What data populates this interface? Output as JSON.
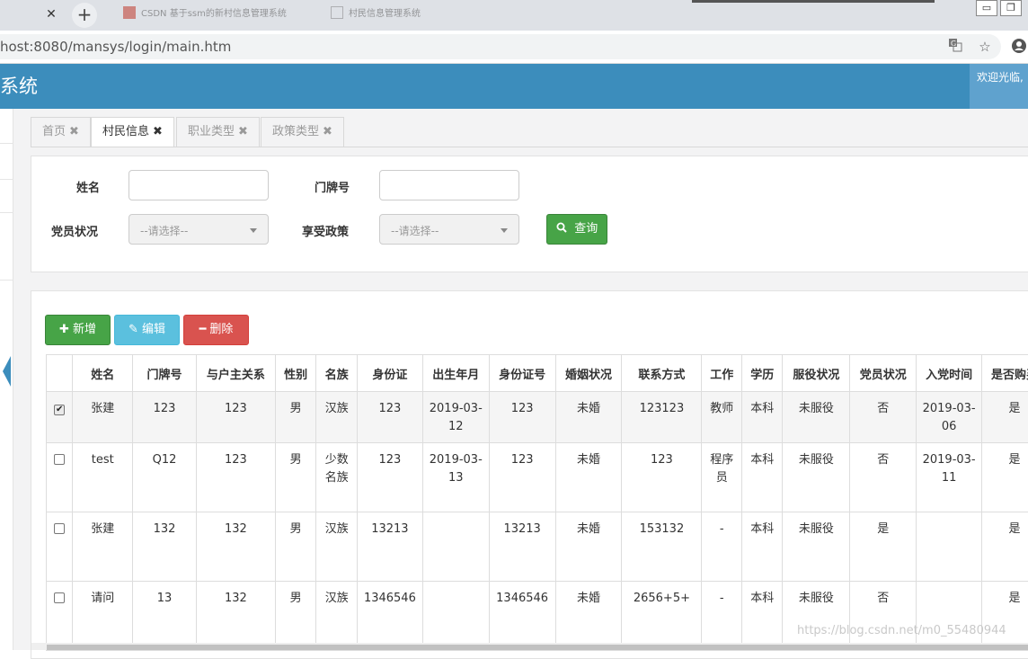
{
  "browser": {
    "tabs": [
      {
        "label": "CSDN 基于ssm的新村信息管理系统"
      },
      {
        "label": "村民信息管理系统"
      }
    ],
    "new_tab_label": "+",
    "close_glyph": "✕",
    "url": "host:8080/mansys/login/main.htm",
    "icons": [
      "translate-icon",
      "star-icon",
      "profile-icon"
    ],
    "window_buttons": {
      "minimize": "▭",
      "restore": "❐"
    }
  },
  "app": {
    "title": "系统",
    "welcome": "欢迎光临,",
    "accent_color": "#3c8dbc"
  },
  "page_tabs": [
    {
      "label": "首页",
      "close": "✖",
      "active": false
    },
    {
      "label": "村民信息",
      "close": "✖",
      "active": true
    },
    {
      "label": "职业类型",
      "close": "✖",
      "active": false
    },
    {
      "label": "政策类型",
      "close": "✖",
      "active": false
    }
  ],
  "search": {
    "name_label": "姓名",
    "name_value": "",
    "door_label": "门牌号",
    "door_value": "",
    "party_label": "党员状况",
    "party_select": "--请选择--",
    "policy_label": "享受政策",
    "policy_select": "--请选择--",
    "search_button": "查询",
    "search_icon": "search-icon"
  },
  "toolbar": {
    "add_label": "新增",
    "edit_label": "编辑",
    "delete_label": "删除"
  },
  "table": {
    "columns": [
      "姓名",
      "门牌号",
      "与户主关系",
      "性别",
      "名族",
      "身份证",
      "出生年月",
      "身份证号",
      "婚姻状况",
      "联系方式",
      "工作",
      "学历",
      "服役状况",
      "党员状况",
      "入党时间",
      "是否购买"
    ],
    "rows": [
      {
        "checked": true,
        "cells": [
          "张建",
          "123",
          "123",
          "男",
          "汉族",
          "123",
          "2019-03-12",
          "123",
          "未婚",
          "123123",
          "教师",
          "本科",
          "未服役",
          "否",
          "2019-03-06",
          "是"
        ]
      },
      {
        "checked": false,
        "cells": [
          "test",
          "Q12",
          "123",
          "男",
          "少数名族",
          "123",
          "2019-03-13",
          "123",
          "未婚",
          "123",
          "程序员",
          "本科",
          "未服役",
          "否",
          "2019-03-11",
          "是"
        ]
      },
      {
        "checked": false,
        "cells": [
          "张建",
          "132",
          "132",
          "男",
          "汉族",
          "13213",
          "",
          "13213",
          "未婚",
          "153132",
          "-",
          "本科",
          "未服役",
          "是",
          "",
          "是"
        ]
      },
      {
        "checked": false,
        "cells": [
          "请问",
          "13",
          "132",
          "男",
          "汉族",
          "1346546",
          "",
          "1346546",
          "未婚",
          "2656+5+",
          "-",
          "本科",
          "未服役",
          "否",
          "",
          "是"
        ]
      }
    ]
  },
  "watermark": "https://blog.csdn.net/m0_55480944"
}
